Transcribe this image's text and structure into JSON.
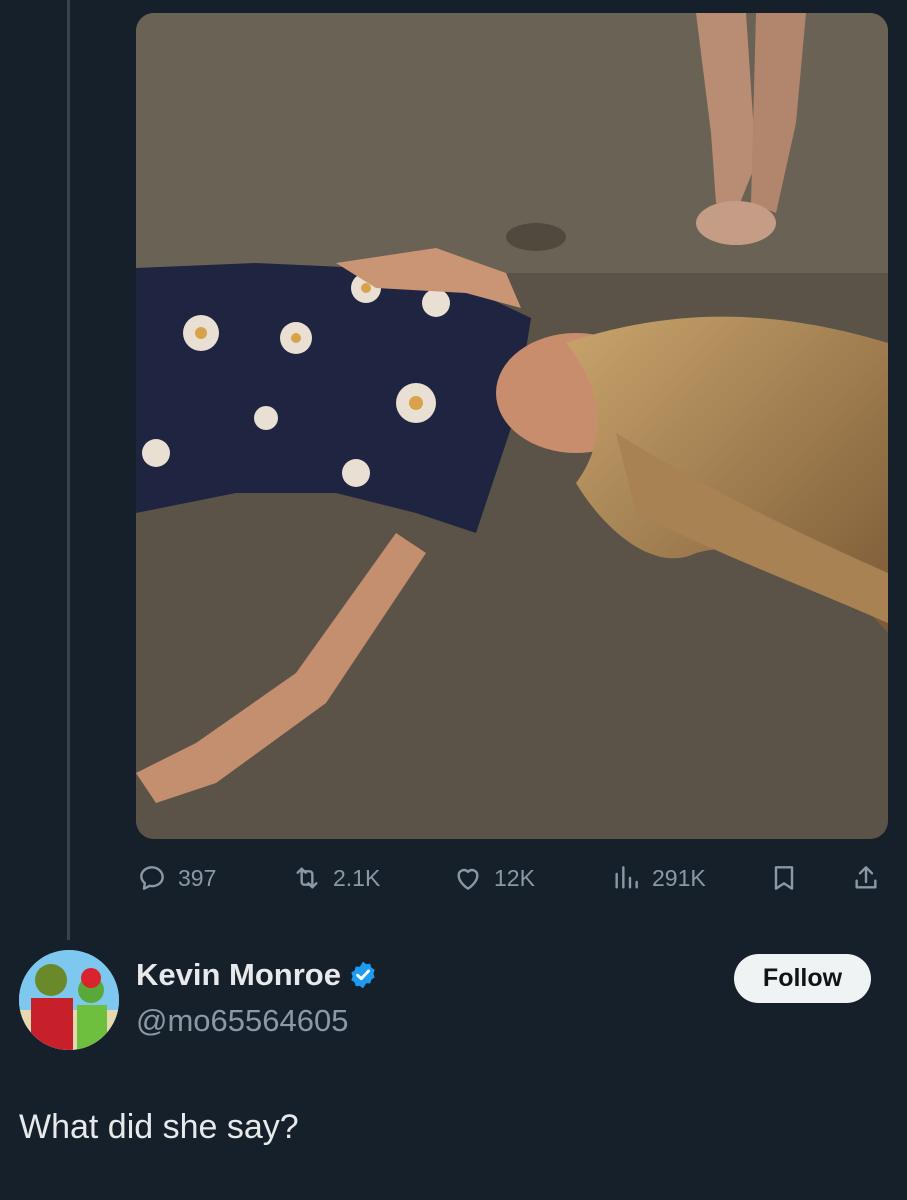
{
  "tweet": {
    "media": {
      "icon": "video-still-image"
    },
    "actions": {
      "replies": "397",
      "retweets": "2.1K",
      "likes": "12K",
      "views": "291K"
    }
  },
  "reply": {
    "author": {
      "display_name": "Kevin Monroe",
      "handle": "@mo65564605",
      "verified": true
    },
    "follow_label": "Follow",
    "text": "What did she say?"
  },
  "colors": {
    "background": "#15202b",
    "text": "#e7e9ea",
    "muted": "#8b98a5",
    "verified": "#1d9bf0",
    "button_bg": "#eff3f4"
  }
}
